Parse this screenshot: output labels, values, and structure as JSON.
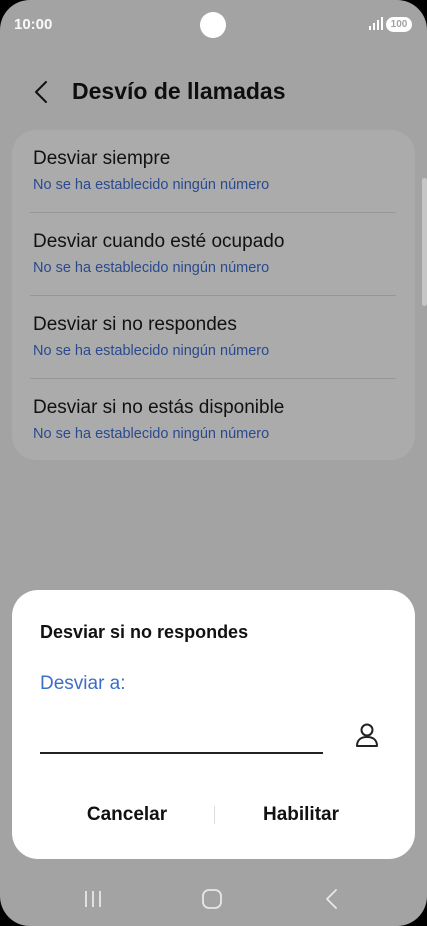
{
  "status_bar": {
    "time": "10:00",
    "battery": "100"
  },
  "header": {
    "title": "Desvío de llamadas"
  },
  "forwarding_options": [
    {
      "title": "Desviar siempre",
      "subtitle": "No se ha establecido ningún número"
    },
    {
      "title": "Desviar cuando esté ocupado",
      "subtitle": "No se ha establecido ningún número"
    },
    {
      "title": "Desviar si no respondes",
      "subtitle": "No se ha establecido ningún número"
    },
    {
      "title": "Desviar si no estás disponible",
      "subtitle": "No se ha establecido ningún número"
    }
  ],
  "dialog": {
    "title": "Desviar si no respondes",
    "field_label": "Desviar a:",
    "field_value": "",
    "cancel_label": "Cancelar",
    "enable_label": "Habilitar"
  },
  "icons": {
    "back": "chevron-left-icon",
    "contacts": "person-icon",
    "nav_recents": "recent-apps-icon",
    "nav_home": "home-icon",
    "nav_back": "back-icon"
  },
  "colors": {
    "scrim_background": "#a3a3a3",
    "subtitle_blue": "#2a4a8f",
    "accent_blue": "#3e6dc8",
    "dialog_background": "#ffffff"
  }
}
